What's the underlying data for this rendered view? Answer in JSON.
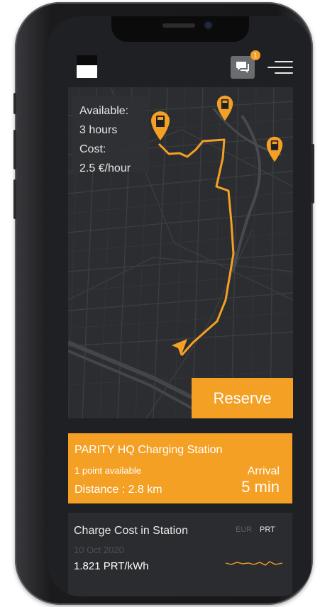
{
  "header": {
    "chat_badge_count": "1"
  },
  "map": {
    "info": {
      "available_label": "Available:",
      "available_value": "3 hours",
      "cost_label": "Cost:",
      "cost_value": "2.5 €/hour"
    },
    "reserve_label": "Reserve"
  },
  "station": {
    "name": "PARITY HQ Charging Station",
    "availability": "1 point available",
    "distance": "Distance : 2.8 km",
    "arrival_label": "Arrival",
    "arrival_value": "5 min"
  },
  "cost": {
    "title": "Charge Cost in Station",
    "currencies": [
      "EUR",
      "PRT"
    ],
    "selected_currency": "PRT",
    "date": "10 Oct 2020",
    "value": "1.821 PRT/kWh"
  },
  "colors": {
    "accent": "#f4a025",
    "background": "#1f2023",
    "map_bg": "#2c2d30",
    "card_bg": "#2b2c2f"
  },
  "icons": [
    "chat-icon",
    "menu-icon",
    "charging-station-pin-icon",
    "navigation-arrow-icon"
  ]
}
